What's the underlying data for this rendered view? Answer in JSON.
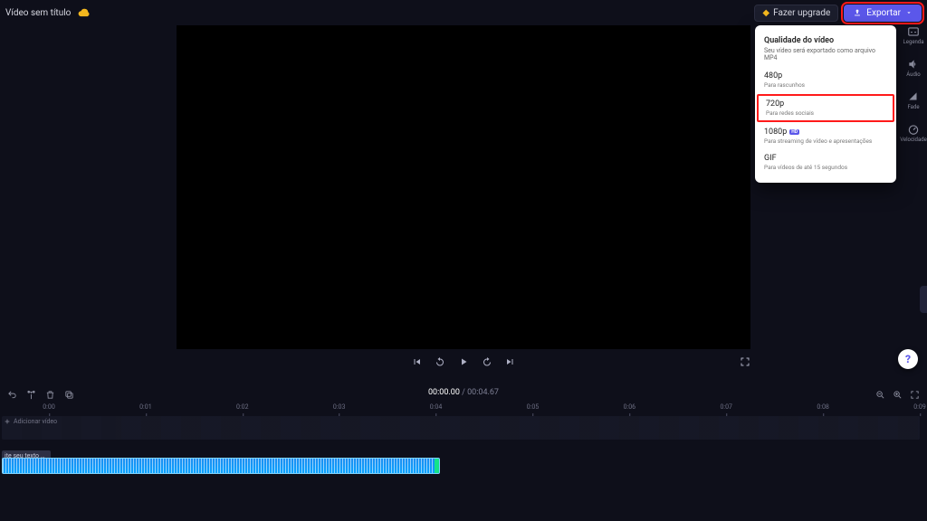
{
  "header": {
    "title": "Vídeo sem título",
    "upgrade_label": "Fazer upgrade",
    "export_label": "Exportar"
  },
  "rightPanel": {
    "captions": "Legenda",
    "audio": "Áudio",
    "fade": "Fade",
    "speed": "Velocidade"
  },
  "exportMenu": {
    "heading": "Qualidade do vídeo",
    "subheading": "Seu vídeo será exportado como arquivo MP4",
    "options": [
      {
        "title": "480p",
        "sub": "Para rascunhos",
        "hd": false
      },
      {
        "title": "720p",
        "sub": "Para redes sociais",
        "hd": false
      },
      {
        "title": "1080p",
        "sub": "Para streaming de vídeo e apresentações",
        "hd": true
      },
      {
        "title": "GIF",
        "sub": "Para vídeos de até 15 segundos",
        "hd": false
      }
    ],
    "highlightedIndex": 1
  },
  "player": {
    "current": "00:00.00",
    "total": "00:04.67"
  },
  "ruler": {
    "ticks": [
      "0:00",
      "0:01",
      "0:02",
      "0:03",
      "0:04",
      "0:05",
      "0:06",
      "0:07",
      "0:08",
      "0:09"
    ]
  },
  "tracks": {
    "addVideoLabel": "Adicionar vídeo",
    "textClip": "ite seu texto p..."
  },
  "help": "?"
}
